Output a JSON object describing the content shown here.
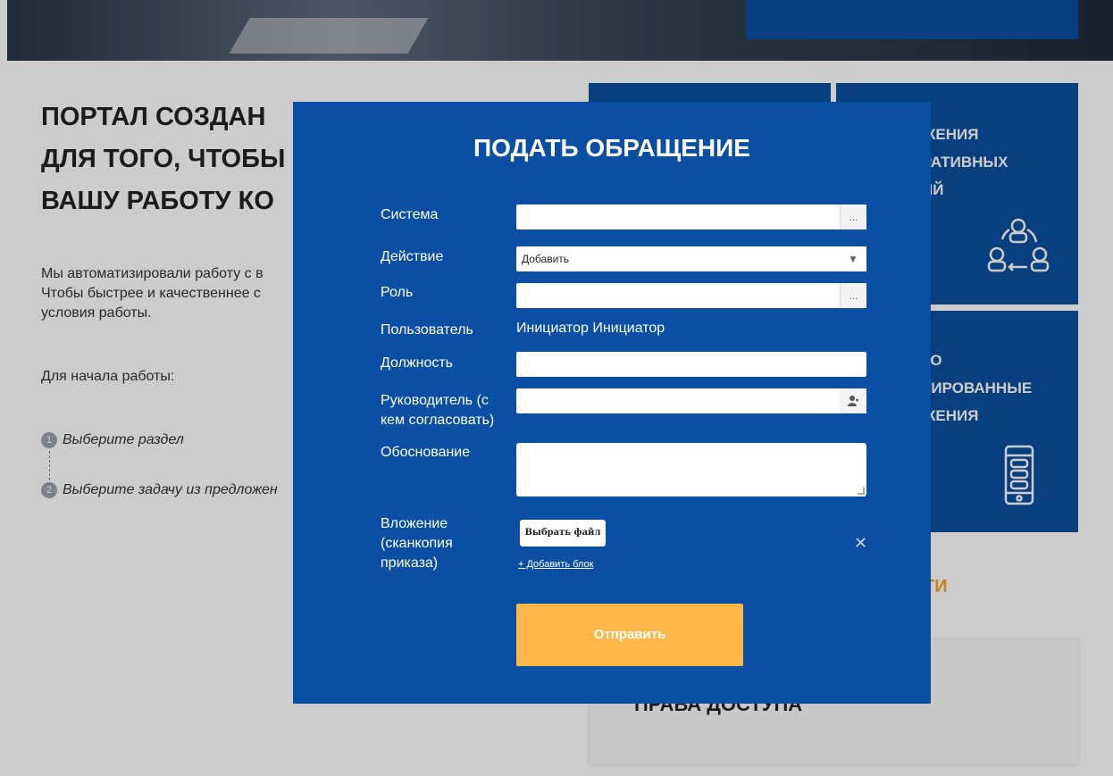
{
  "background": {
    "heading_lines": [
      "ПОРТАЛ СОЗДАН",
      "ДЛЯ ТОГО, ЧТОБЫ",
      "ВАШУ РАБОТУ КО"
    ],
    "text_lines": [
      "Мы автоматизировали работу с в",
      "Чтобы быстрее и качественнее с",
      "условия работы."
    ],
    "start_label": "Для начала работы:",
    "steps": [
      {
        "num": "1",
        "label": "Выберите раздел"
      },
      {
        "num": "2",
        "label": "Выберите задачу из предложен"
      }
    ],
    "tile_top_lines": [
      "ЖЕНИЯ",
      "РАТИВНЫХ",
      "ИЙ"
    ],
    "tile_bottom_lines": [
      "ГО",
      "ТИРОВАННЫЕ",
      "ЖЕНИЯ"
    ],
    "section_head": "ТИ",
    "card_title": "ПРАВА ДОСТУПА",
    "colors": {
      "primary": "#0a4fa3",
      "accent": "#f5b23c"
    }
  },
  "modal": {
    "title": "ПОДАТЬ ОБРАЩЕНИЕ",
    "labels": {
      "system": "Система",
      "action": "Действие",
      "role": "Роль",
      "user": "Пользователь",
      "position": "Должность",
      "manager_lines": [
        "Руководитель (с",
        "кем согласовать)"
      ],
      "reason": "Обоснование",
      "attachment_lines": [
        "Вложение",
        "(сканкопия",
        "приказа)"
      ]
    },
    "values": {
      "system": "",
      "action": "Добавить",
      "role": "",
      "user": "Инициатор Инициатор",
      "position": "",
      "manager": "",
      "reason": ""
    },
    "ellipsis": "...",
    "dropdown_arrow": "▼",
    "file_button": "Выбрать файл",
    "add_block_link": "+ Добавить блок",
    "close_symbol": "✕",
    "submit": "Отправить"
  }
}
